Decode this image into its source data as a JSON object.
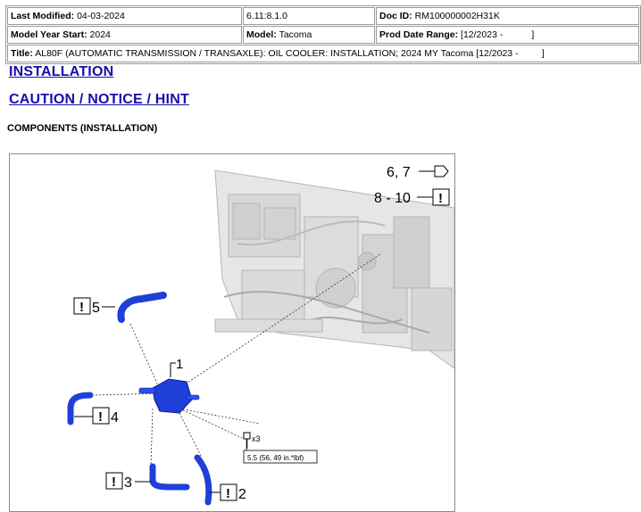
{
  "meta": {
    "last_modified_label": "Last Modified:",
    "last_modified": "04-03-2024",
    "version": "6.11:8.1.0",
    "doc_id_label": "Doc ID:",
    "doc_id": "RM100000002H31K",
    "model_year_label": "Model Year Start:",
    "model_year": "2024",
    "model_label": "Model:",
    "model": "Tacoma",
    "prod_range_label": "Prod Date Range:",
    "prod_range": "[12/2023 -           ]",
    "title_label": "Title:",
    "title": "AL80F (AUTOMATIC TRANSMISSION / TRANSAXLE): OIL COOLER: INSTALLATION; 2024 MY Tacoma [12/2023 -         ]"
  },
  "links": {
    "installation": "INSTALLATION",
    "caution": "CAUTION / NOTICE / HINT"
  },
  "section_title": "COMPONENTS (INSTALLATION)",
  "figure": {
    "label_6_7": "6, 7",
    "label_8_10": "8 - 10",
    "label_5": "5",
    "label_4": "4",
    "label_3": "3",
    "label_2": "2",
    "label_1": "1",
    "qty": "x3",
    "torque": "5.5 (56, 49 in.*lbf)",
    "notice_mark": "!"
  },
  "colors": {
    "link": "#1a0dab",
    "part_blue": "#1f3fd8"
  }
}
